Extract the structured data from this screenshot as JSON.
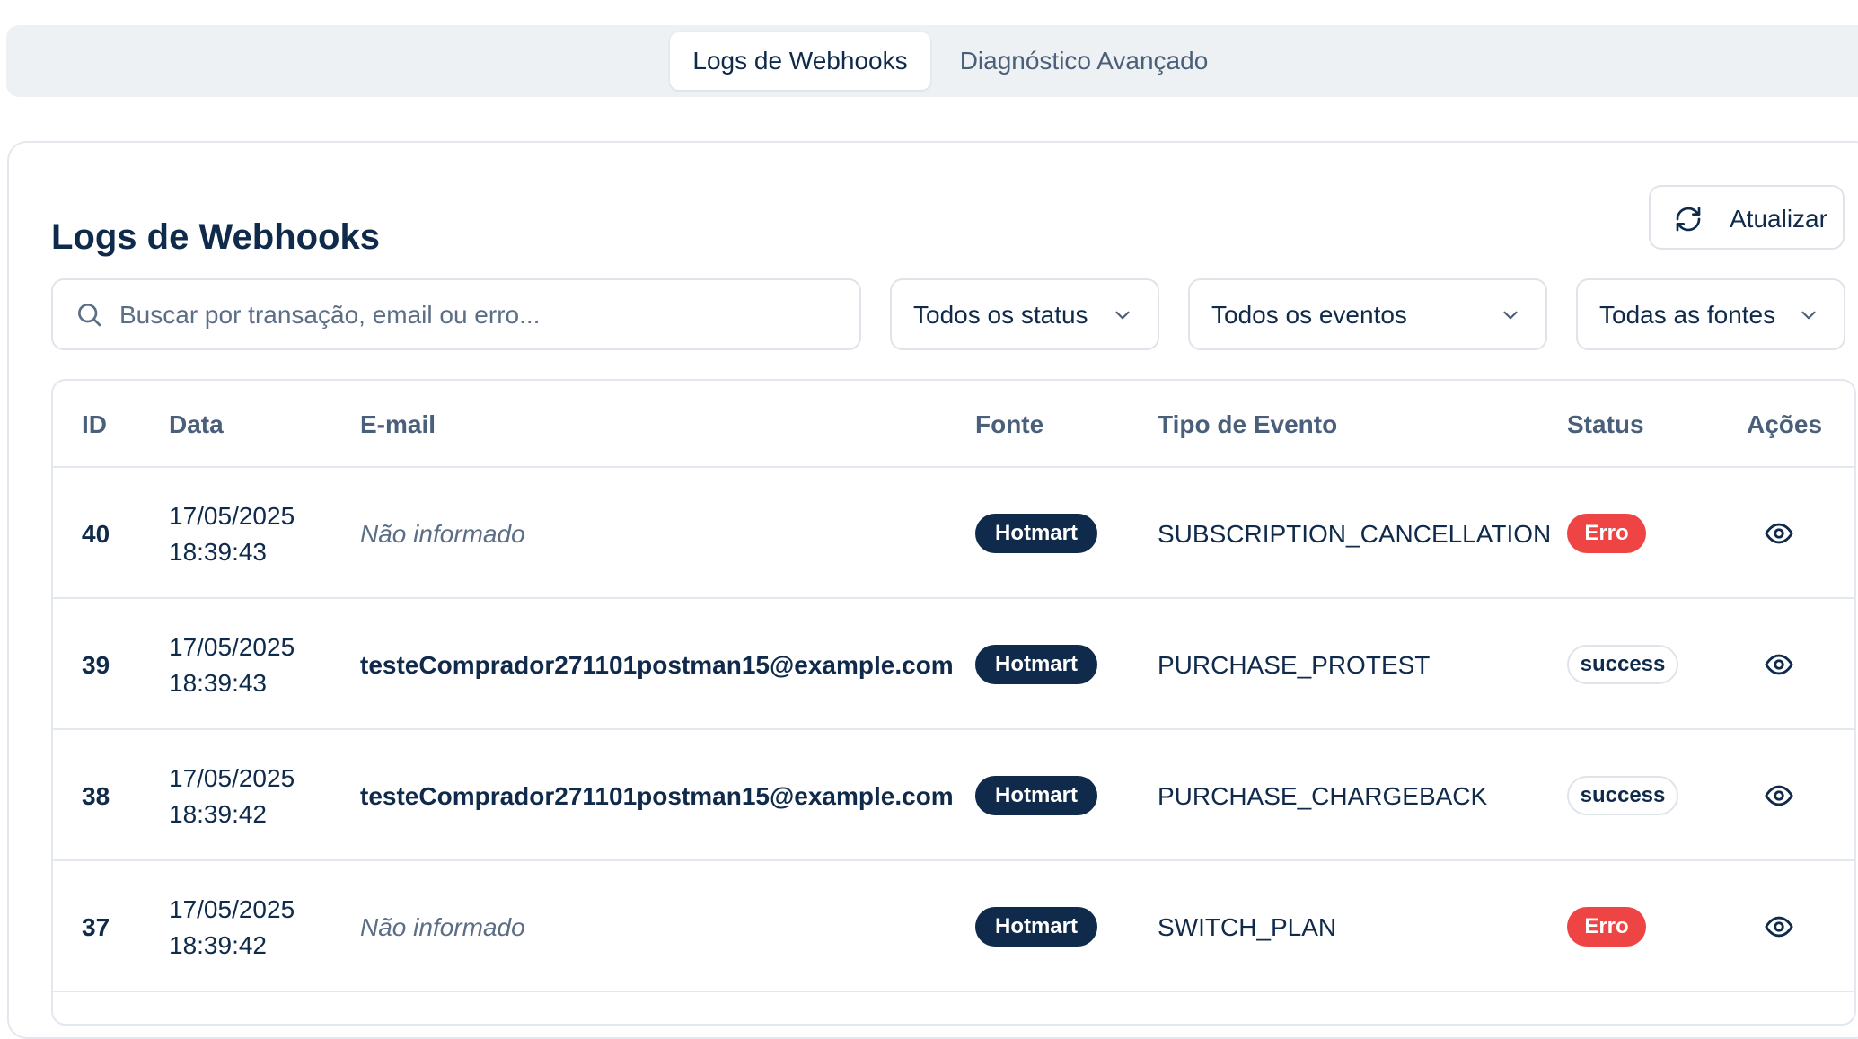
{
  "tabs": [
    {
      "label": "Logs de Webhooks",
      "active": true
    },
    {
      "label": "Diagnóstico Avançado",
      "active": false
    }
  ],
  "header": {
    "title": "Logs de Webhooks",
    "refresh_label": "Atualizar"
  },
  "filters": {
    "search_placeholder": "Buscar por transação, email ou erro...",
    "status": "Todos os status",
    "events": "Todos os eventos",
    "sources": "Todas as fontes"
  },
  "table": {
    "columns": [
      "ID",
      "Data",
      "E-mail",
      "Fonte",
      "Tipo de Evento",
      "Status",
      "Ações"
    ],
    "rows": [
      {
        "id": "40",
        "date": "17/05/2025",
        "time": "18:39:43",
        "email": "Não informado",
        "source": "Hotmart",
        "event": "SUBSCRIPTION_CANCELLATION",
        "status": "Erro"
      },
      {
        "id": "39",
        "date": "17/05/2025",
        "time": "18:39:43",
        "email": "testeComprador271101postman15@example.com",
        "source": "Hotmart",
        "event": "PURCHASE_PROTEST",
        "status": "success"
      },
      {
        "id": "38",
        "date": "17/05/2025",
        "time": "18:39:42",
        "email": "testeComprador271101postman15@example.com",
        "source": "Hotmart",
        "event": "PURCHASE_CHARGEBACK",
        "status": "success"
      },
      {
        "id": "37",
        "date": "17/05/2025",
        "time": "18:39:42",
        "email": "Não informado",
        "source": "Hotmart",
        "event": "SWITCH_PLAN",
        "status": "Erro"
      }
    ]
  },
  "colors": {
    "primary": "#0f2a4a",
    "muted": "#4a5f7a",
    "error": "#ef4444",
    "border": "#e3e8ee",
    "tabbar_bg": "#eef1f4"
  },
  "icons": {
    "refresh": "refresh-icon",
    "search": "search-icon",
    "chevron": "chevron-down-icon",
    "view": "eye-icon"
  }
}
